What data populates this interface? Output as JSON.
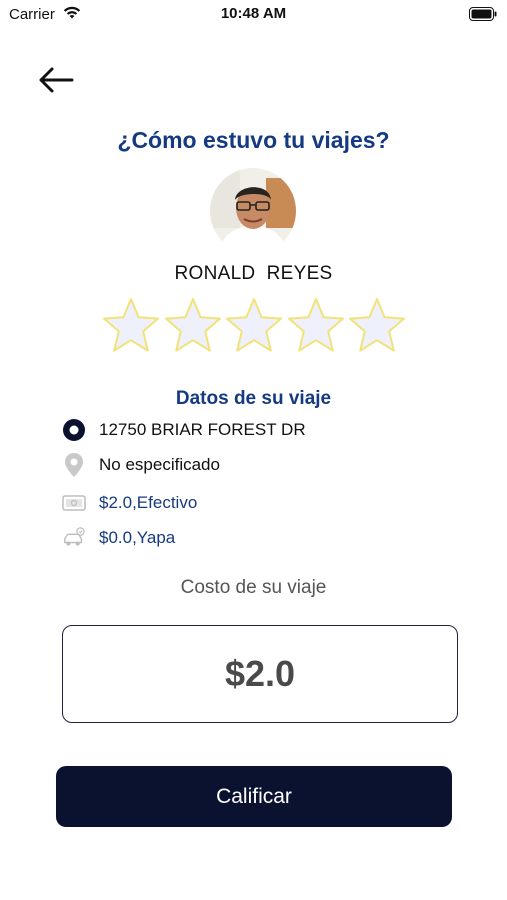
{
  "status_bar": {
    "carrier": "Carrier",
    "time": "10:48 AM"
  },
  "header": {
    "title": "¿Cómo estuvo tu viajes?"
  },
  "driver": {
    "name": "RONALD  REYES"
  },
  "rating": {
    "max": 5,
    "value": 0
  },
  "trip": {
    "section_title": "Datos de su viaje",
    "origin": "12750 BRIAR FOREST DR",
    "destination": "No especificado",
    "payment": "$2.0,Efectivo",
    "tip": "$0.0,Yapa"
  },
  "cost": {
    "label": "Costo de su viaje",
    "value": "$2.0"
  },
  "actions": {
    "rate_label": "Calificar"
  },
  "colors": {
    "brand_blue": "#163a82",
    "button_dark": "#0b1230",
    "star_outline": "#f2e27a",
    "star_fill": "#eef0fb"
  }
}
